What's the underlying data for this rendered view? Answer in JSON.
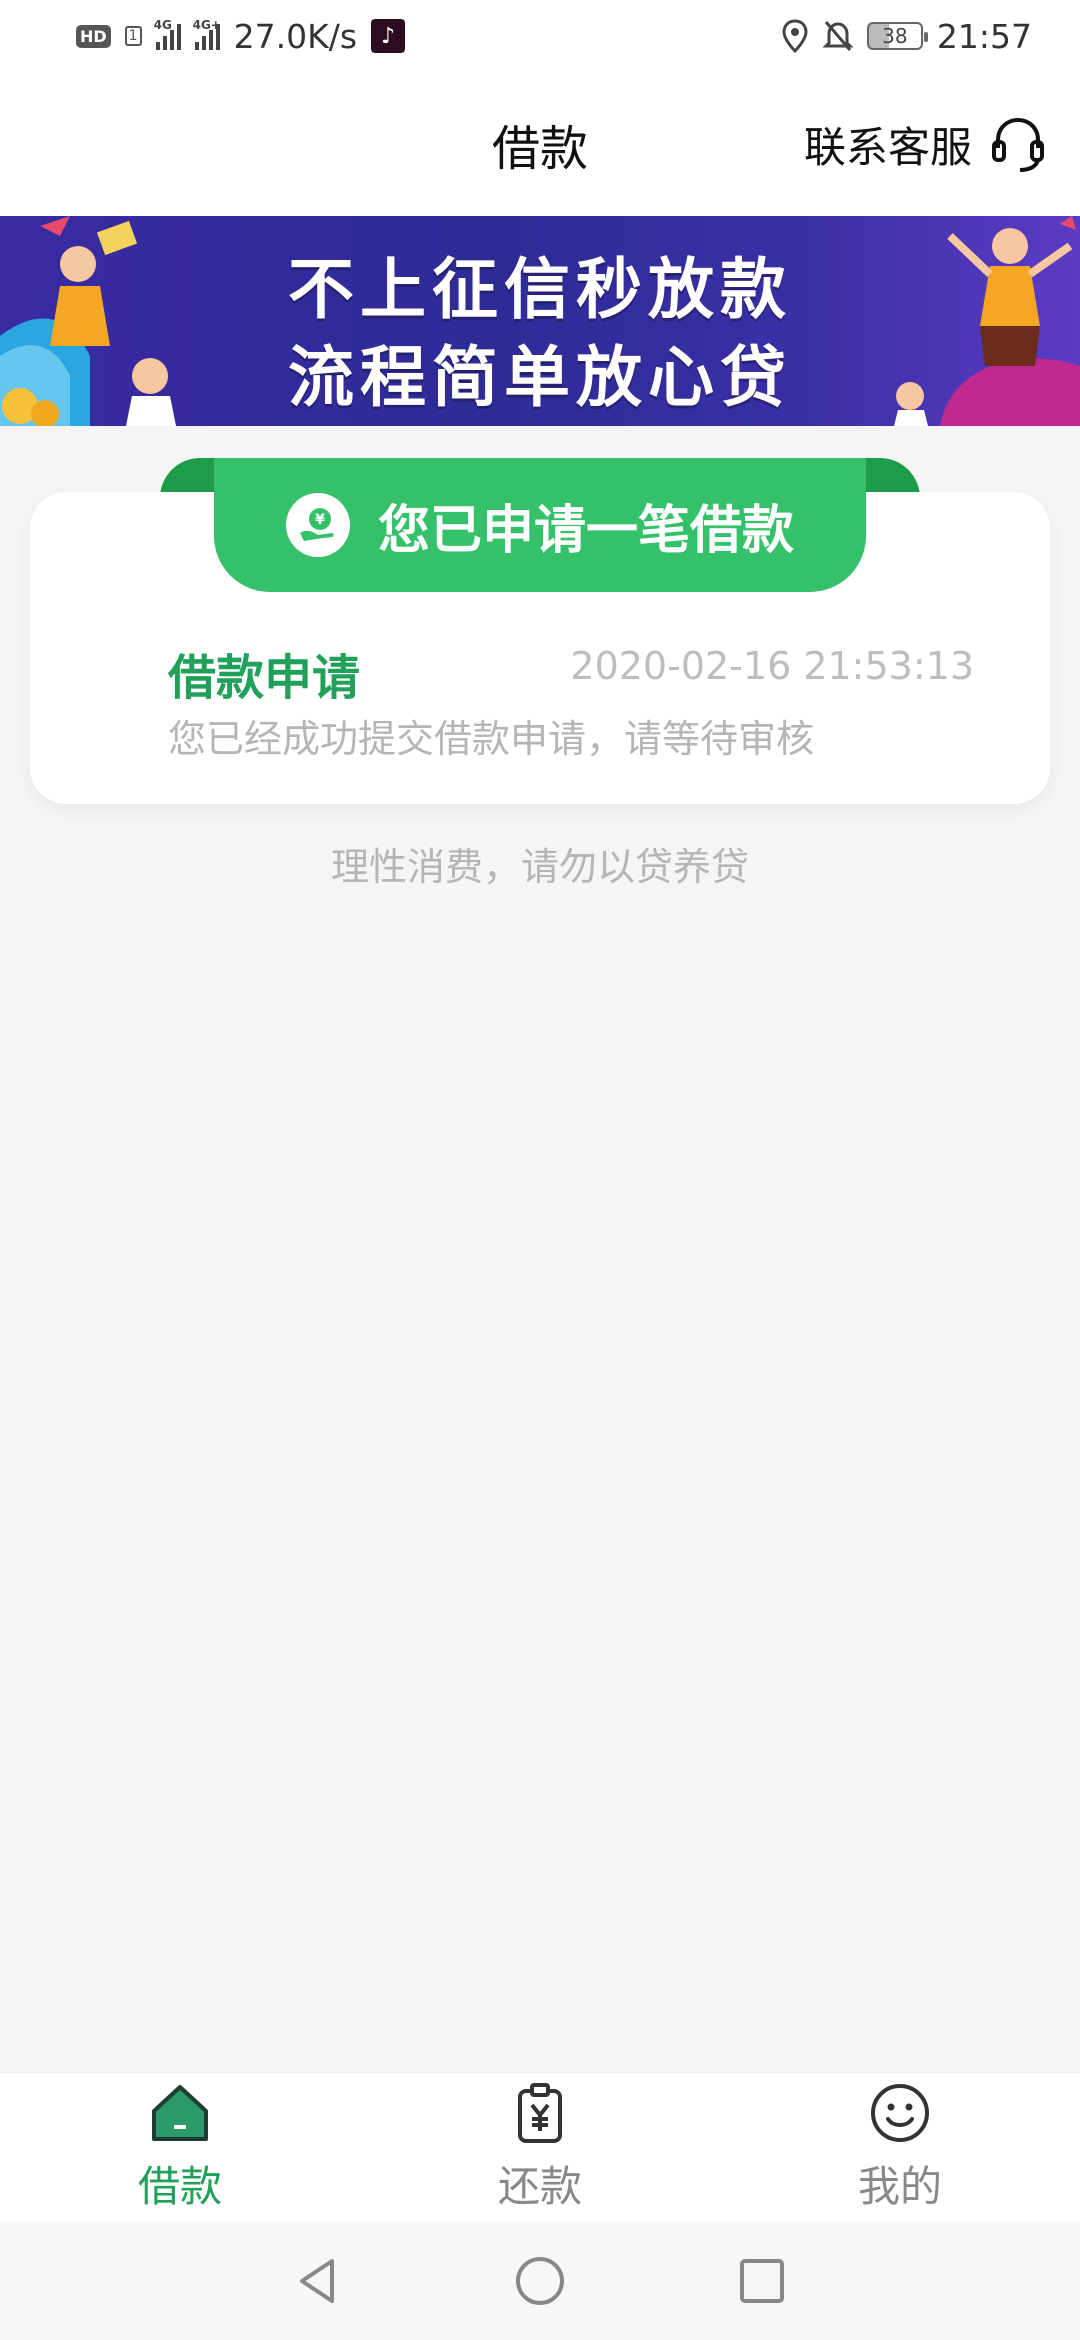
{
  "status_bar": {
    "hd_label": "HD",
    "sim_slot": "1",
    "net1": "4G",
    "net2": "4G+",
    "speed": "27.0K/s",
    "battery": "38",
    "time": "21:57"
  },
  "header": {
    "title": "借款",
    "support_label": "联系客服"
  },
  "banner": {
    "line1": "不上征信秒放款",
    "line2": "流程简单放心贷"
  },
  "application": {
    "status_banner": "您已申请一笔借款",
    "record_title": "借款申请",
    "record_time": "2020-02-16 21:53:13",
    "record_desc": "您已经成功提交借款申请，请等待审核"
  },
  "notice": "理性消费，请勿以贷养贷",
  "tabs": [
    {
      "label": "借款",
      "icon": "home-icon",
      "active": true
    },
    {
      "label": "还款",
      "icon": "repay-clipboard-icon",
      "active": false
    },
    {
      "label": "我的",
      "icon": "smiley-icon",
      "active": false
    }
  ],
  "colors": {
    "accent_green": "#21a05a",
    "tab_green": "#35c06a",
    "banner_purple": "#2e2b96"
  }
}
